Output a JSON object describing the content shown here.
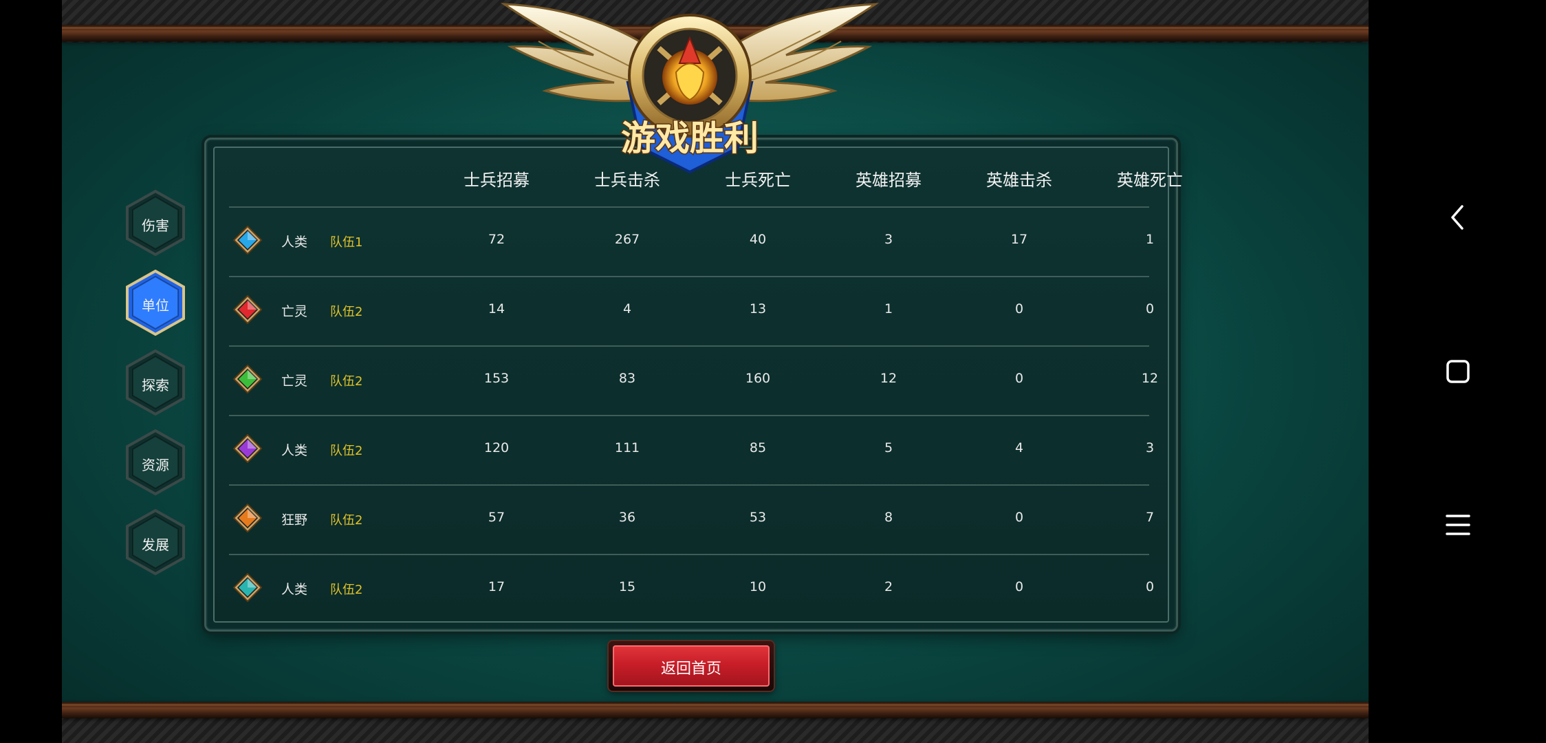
{
  "emblem": {
    "title": "游戏胜利"
  },
  "tabs": [
    {
      "label": "伤害",
      "active": false
    },
    {
      "label": "单位",
      "active": true
    },
    {
      "label": "探索",
      "active": false
    },
    {
      "label": "资源",
      "active": false
    },
    {
      "label": "发展",
      "active": false
    }
  ],
  "table": {
    "columns": [
      "士兵招募",
      "士兵击杀",
      "士兵死亡",
      "英雄招募",
      "英雄击杀",
      "英雄死亡"
    ],
    "rows": [
      {
        "gem": "#27a6e8",
        "race": "人类",
        "team": "队伍1",
        "values": [
          "72",
          "267",
          "40",
          "3",
          "17",
          "1"
        ]
      },
      {
        "gem": "#e0282e",
        "race": "亡灵",
        "team": "队伍2",
        "values": [
          "14",
          "4",
          "13",
          "1",
          "0",
          "0"
        ]
      },
      {
        "gem": "#3cbe3a",
        "race": "亡灵",
        "team": "队伍2",
        "values": [
          "153",
          "83",
          "160",
          "12",
          "0",
          "12"
        ]
      },
      {
        "gem": "#9a3ad6",
        "race": "人类",
        "team": "队伍2",
        "values": [
          "120",
          "111",
          "85",
          "5",
          "4",
          "3"
        ]
      },
      {
        "gem": "#e67a1c",
        "race": "狂野",
        "team": "队伍2",
        "values": [
          "57",
          "36",
          "53",
          "8",
          "0",
          "7"
        ]
      },
      {
        "gem": "#2ab4b0",
        "race": "人类",
        "team": "队伍2",
        "values": [
          "17",
          "15",
          "10",
          "2",
          "0",
          "0"
        ]
      }
    ]
  },
  "return_button": {
    "label": "返回首页"
  },
  "nav": {
    "icons": [
      "back-icon",
      "home-icon",
      "menu-icon"
    ]
  }
}
